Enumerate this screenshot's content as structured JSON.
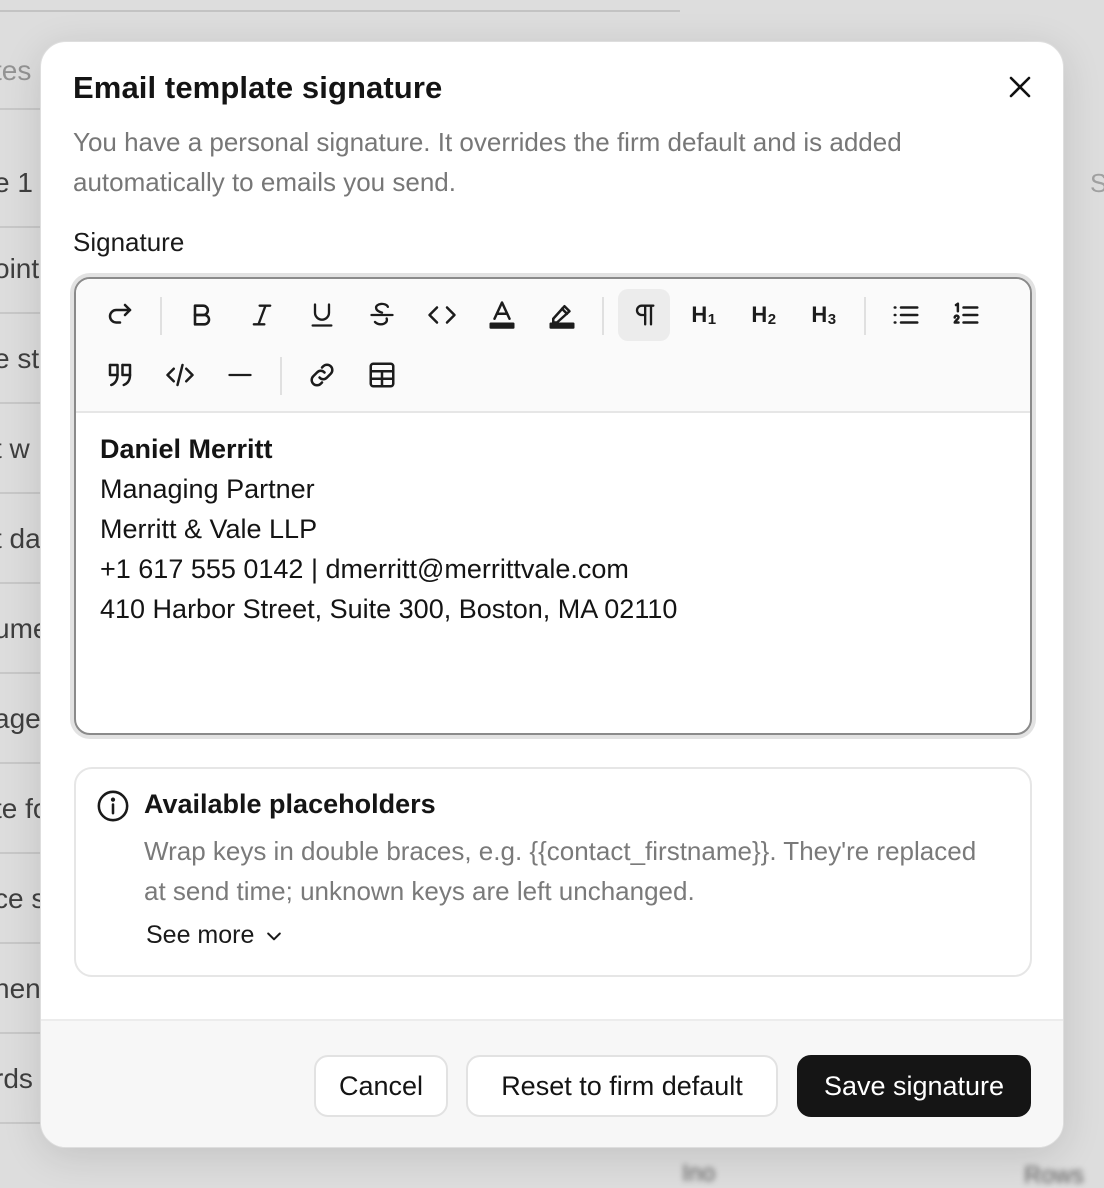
{
  "background": {
    "rows": [
      "tes",
      "e 1",
      "oint",
      "e sta",
      "t w",
      "t da",
      "ume",
      "ager",
      "te fo",
      "ce s",
      "nen",
      "rds"
    ],
    "blur_left": "Ino",
    "blur_right": "Rows",
    "right_edge_text": "S"
  },
  "modal": {
    "title": "Email template signature",
    "description": "You have a personal signature. It overrides the firm default and is added automatically to emails you send.",
    "signature_label": "Signature",
    "close_icon": "close-icon"
  },
  "toolbar": {
    "buttons": [
      {
        "name": "redo",
        "icon": "redo-icon"
      },
      {
        "name": "bold",
        "icon": "bold-icon"
      },
      {
        "name": "italic",
        "icon": "italic-icon"
      },
      {
        "name": "underline",
        "icon": "underline-icon"
      },
      {
        "name": "strikethrough",
        "icon": "strikethrough-icon"
      },
      {
        "name": "inline-code",
        "icon": "code-icon"
      },
      {
        "name": "text-color",
        "icon": "text-color-icon"
      },
      {
        "name": "highlight",
        "icon": "highlighter-icon"
      },
      {
        "name": "paragraph",
        "icon": "pilcrow-icon",
        "active": true
      },
      {
        "name": "heading-1",
        "icon": "heading-1-icon"
      },
      {
        "name": "heading-2",
        "icon": "heading-2-icon"
      },
      {
        "name": "heading-3",
        "icon": "heading-3-icon"
      },
      {
        "name": "bullet-list",
        "icon": "bullet-list-icon"
      },
      {
        "name": "ordered-list",
        "icon": "numbered-list-icon"
      },
      {
        "name": "blockquote",
        "icon": "quote-icon"
      },
      {
        "name": "code-block",
        "icon": "code-block-icon"
      },
      {
        "name": "horizontal-rule",
        "icon": "horizontal-rule-icon"
      },
      {
        "name": "link",
        "icon": "link-icon"
      },
      {
        "name": "table",
        "icon": "table-icon"
      }
    ],
    "h1_label": "H",
    "h1_sub": "1",
    "h2_label": "H",
    "h2_sub": "2",
    "h3_label": "H",
    "h3_sub": "3"
  },
  "signature": {
    "name": "Daniel Merritt",
    "role": "Managing Partner",
    "firm": "Merritt & Vale LLP",
    "contact": "+1 617 555 0142 | dmerritt@merrittvale.com",
    "address": "410 Harbor Street, Suite 300, Boston, MA 02110"
  },
  "placeholders": {
    "title": "Available placeholders",
    "description": "Wrap keys in double braces, e.g. {{contact_firstname}}. They're replaced at send time; unknown keys are left unchanged.",
    "see_more": "See more"
  },
  "footer": {
    "cancel": "Cancel",
    "reset": "Reset to firm default",
    "save": "Save signature"
  },
  "colors": {
    "primary_button": "#151515",
    "muted_text": "#777777",
    "editor_border": "#8a8a8a"
  }
}
